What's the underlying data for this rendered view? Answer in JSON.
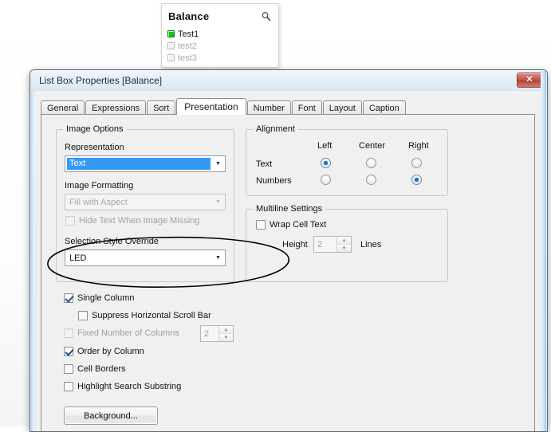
{
  "listbox": {
    "caption": "Balance",
    "search_icon": "magnifier-icon",
    "items": [
      {
        "label": "Test1",
        "state": "selected"
      },
      {
        "label": "test2",
        "state": "unselected"
      },
      {
        "label": "test3",
        "state": "unselected"
      }
    ]
  },
  "dialog": {
    "title": "List Box Properties [Balance]",
    "close_label": "✕",
    "tabs": [
      {
        "label": "General",
        "active": false
      },
      {
        "label": "Expressions",
        "active": false
      },
      {
        "label": "Sort",
        "active": false
      },
      {
        "label": "Presentation",
        "active": true
      },
      {
        "label": "Number",
        "active": false
      },
      {
        "label": "Font",
        "active": false
      },
      {
        "label": "Layout",
        "active": false
      },
      {
        "label": "Caption",
        "active": false
      }
    ]
  },
  "image_options": {
    "group_label": "Image Options",
    "representation_label": "Representation",
    "representation_value": "Text",
    "image_formatting_label": "Image Formatting",
    "image_formatting_value": "Fill with Aspect",
    "hide_text_label": "Hide Text When Image Missing",
    "hide_text_checked": false,
    "selection_style_label": "Selection Style Override",
    "selection_style_value": "LED",
    "dropdown_arrow": "chevron-down-icon"
  },
  "alignment": {
    "group_label": "Alignment",
    "columns": [
      "Left",
      "Center",
      "Right"
    ],
    "rows": [
      {
        "label": "Text",
        "selected": "Left"
      },
      {
        "label": "Numbers",
        "selected": "Right"
      }
    ]
  },
  "multiline": {
    "group_label": "Multiline Settings",
    "wrap_label": "Wrap Cell Text",
    "wrap_checked": false,
    "height_label": "Height",
    "height_value": "2",
    "lines_label": "Lines"
  },
  "options": [
    {
      "label": "Single Column",
      "checked": true,
      "enabled": true
    },
    {
      "label": "Suppress Horizontal Scroll Bar",
      "checked": false,
      "enabled": true
    },
    {
      "label": "Fixed Number of Columns",
      "checked": false,
      "enabled": false
    },
    {
      "label": "Order by Column",
      "checked": true,
      "enabled": true
    },
    {
      "label": "Cell Borders",
      "checked": false,
      "enabled": true
    },
    {
      "label": "Highlight Search Substring",
      "checked": false,
      "enabled": true
    }
  ],
  "columns_spinner_value": "2",
  "background_button": "Background...",
  "colors": {
    "selection_highlight": "#3399f5",
    "radio_dot": "#1b6fc4",
    "led_on": "#19c219",
    "close_button": "#c3584f",
    "annotation_ink": "#000000"
  }
}
